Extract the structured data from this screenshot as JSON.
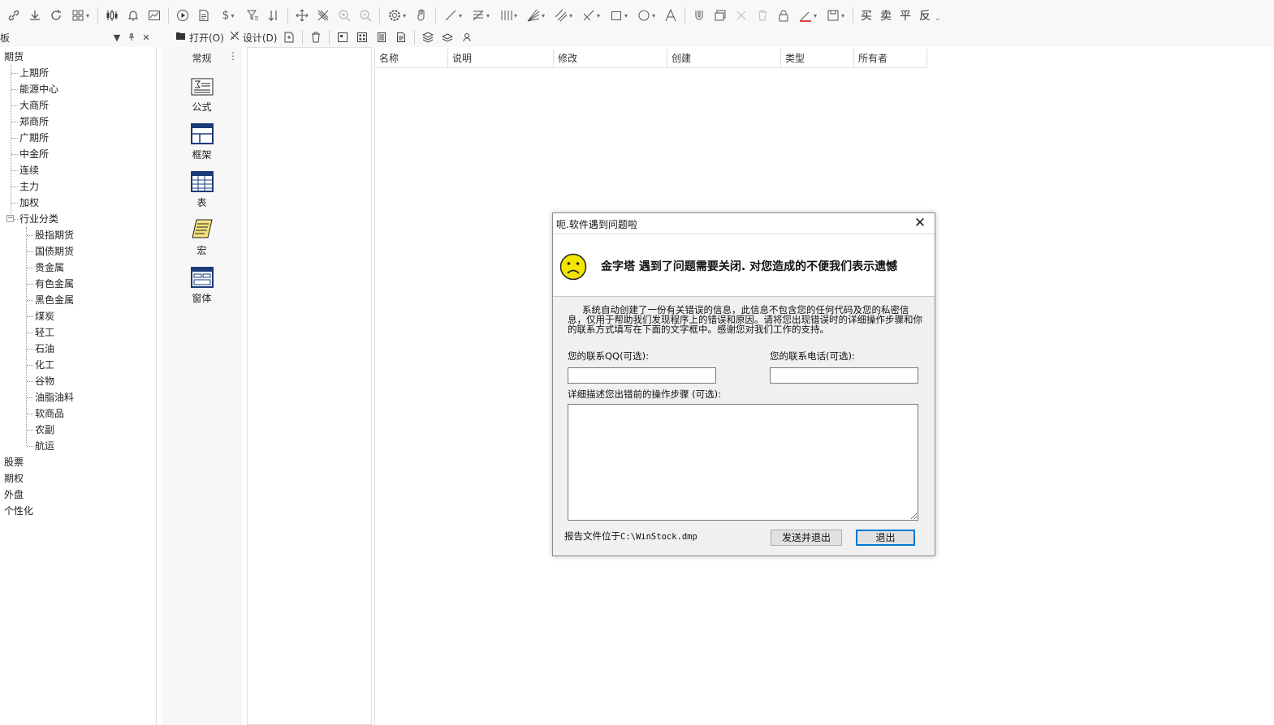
{
  "toolbar": {
    "icons": [
      "link-icon",
      "download-icon",
      "refresh-icon",
      "grid-icon",
      "candlestick-icon",
      "bell-icon",
      "chart-icon",
      "play-icon",
      "document-icon",
      "dollar-icon",
      "filter-icon",
      "sort-icon",
      "move-icon",
      "pattern-icon",
      "zoom-in-icon",
      "zoom-out-icon",
      "gear-icon",
      "hand-icon",
      "line-icon",
      "fib-icon",
      "vbars-icon",
      "fan-icon",
      "parallel-icon",
      "cross-icon",
      "rect-icon",
      "circle-icon",
      "text-icon",
      "magnet-icon",
      "layers-icon",
      "delete-icon",
      "trash-icon",
      "lock-icon",
      "pen-icon",
      "save-icon"
    ],
    "trade_buy": "买",
    "trade_sell": "卖",
    "trade_flat": "平",
    "trade_reverse": "反"
  },
  "panel": {
    "title": "板",
    "open_label": "打开(O)",
    "design_label": "设计(D)"
  },
  "tree": {
    "root_futures": "期货",
    "exchanges": [
      "上期所",
      "能源中心",
      "大商所",
      "郑商所",
      "广期所",
      "中金所",
      "连续",
      "主力",
      "加权"
    ],
    "industry": "行业分类",
    "industries": [
      "股指期货",
      "国债期货",
      "贵金属",
      "有色金属",
      "黑色金属",
      "煤炭",
      "轻工",
      "石油",
      "化工",
      "谷物",
      "油脂油料",
      "软商品",
      "农副",
      "航运"
    ],
    "others": [
      "股票",
      "期权",
      "外盘",
      "个性化"
    ]
  },
  "iconcol": {
    "header": "常规",
    "items": [
      {
        "name": "formula",
        "label": "公式"
      },
      {
        "name": "frame",
        "label": "框架"
      },
      {
        "name": "table",
        "label": "表"
      },
      {
        "name": "macro",
        "label": "宏"
      },
      {
        "name": "window",
        "label": "窗体"
      }
    ]
  },
  "listview": {
    "columns": [
      "名称",
      "说明",
      "修改",
      "创建",
      "类型",
      "所有者"
    ]
  },
  "dialog": {
    "title": "呃.软件遇到问题啦",
    "heading": "金字塔 遇到了问题需要关闭. 对您造成的不便我们表示遗憾",
    "description": "系统自动创建了一份有关错误的信息，此信息不包含您的任何代码及您的私密信息，仅用于帮助我们发现程序上的错误和原因。请将您出现错误时的详细操作步骤和你的联系方式填写在下面的文字框中。感谢您对我们工作的支持。",
    "qq_label": "您的联系QQ(可选):",
    "qq_value": "",
    "phone_label": "您的联系电话(可选):",
    "phone_value": "",
    "steps_label": "详细描述您出错前的操作步骤 (可选):",
    "steps_value": "",
    "report_prefix": "报告文件位于",
    "report_path": "C:\\WinStock.dmp",
    "send_button": "发送并退出",
    "exit_button": "退出"
  }
}
